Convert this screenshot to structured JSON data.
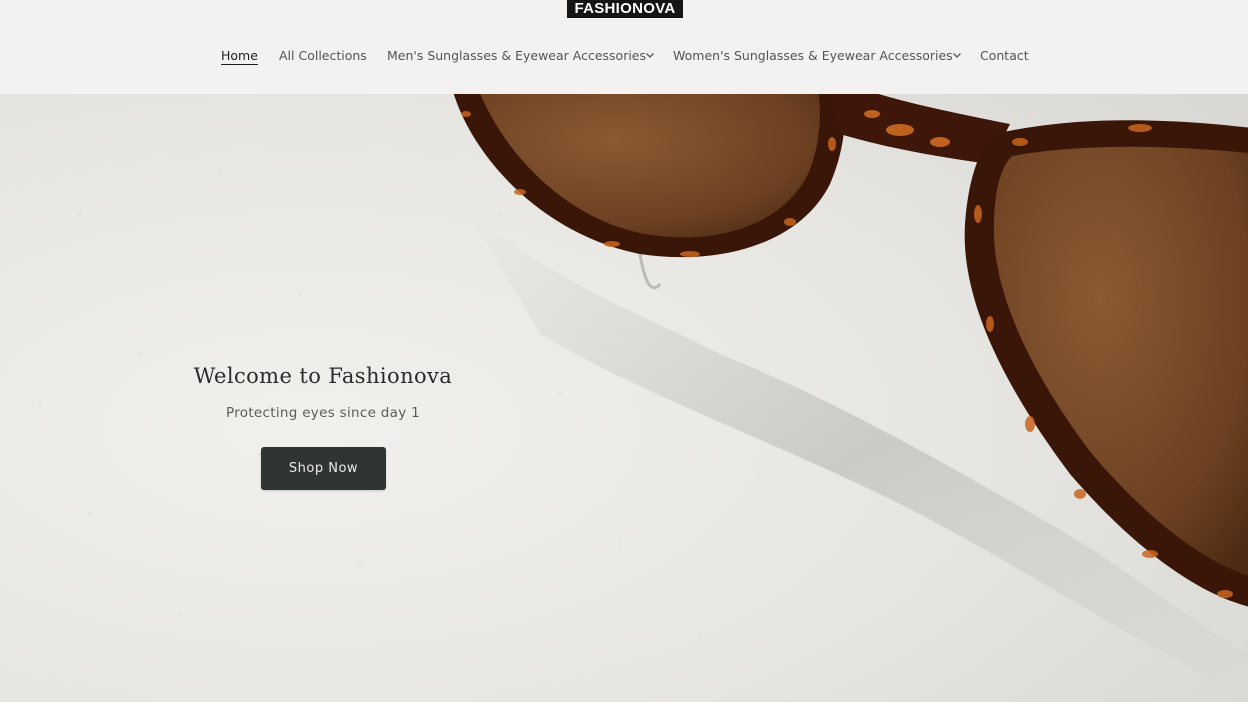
{
  "brand": {
    "logo_text": "FASHIONOVA"
  },
  "nav": {
    "items": [
      {
        "label": "Home",
        "active": true
      },
      {
        "label": "All Collections"
      },
      {
        "label": "Men's Sunglasses & Eyewear Accessories",
        "has_dropdown": true
      },
      {
        "label": "Women's Sunglasses & Eyewear Accessories",
        "has_dropdown": true
      },
      {
        "label": "Contact"
      }
    ]
  },
  "hero": {
    "title": "Welcome to Fashionova",
    "subtitle": "Protecting eyes since day 1",
    "cta_label": "Shop Now",
    "image": "brown-tortoiseshell-sunglasses-on-white-wall"
  },
  "colors": {
    "header_bg": "#f3f2f1",
    "logo_bg": "#151515",
    "button_bg": "#2f3532",
    "lens": "#7a4a24",
    "frame": "#3a1608",
    "tortoise_accent": "#c9651f"
  }
}
